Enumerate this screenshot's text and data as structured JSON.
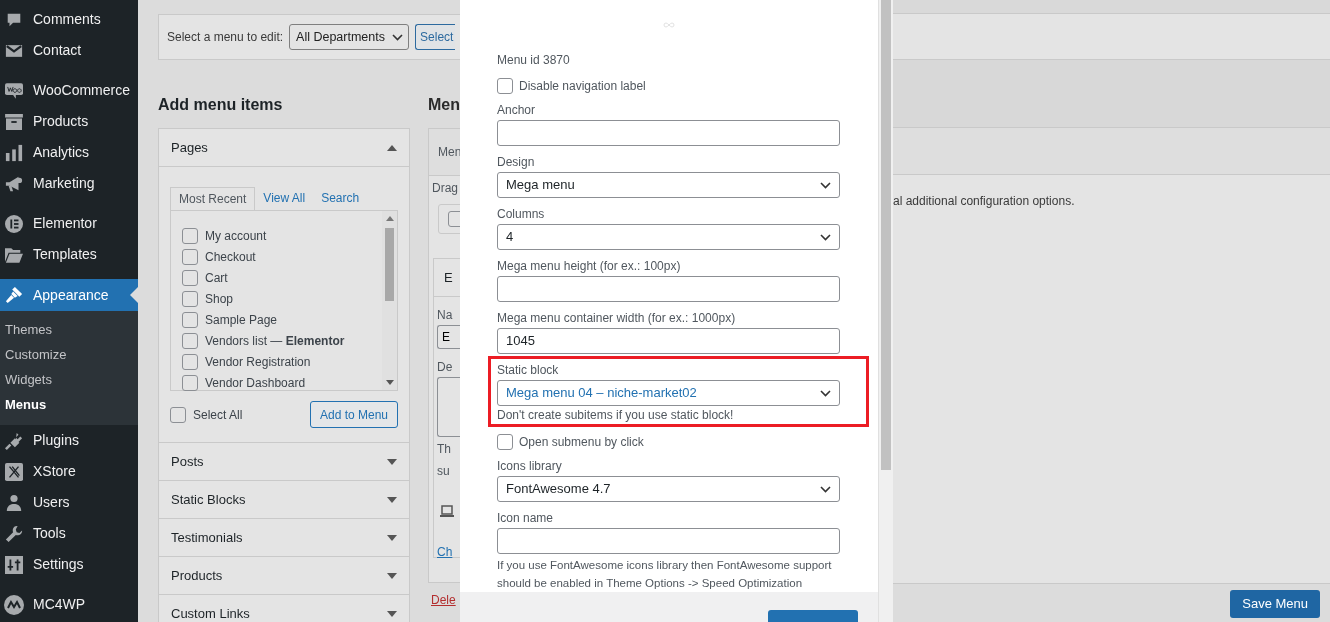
{
  "sidebar": {
    "items": [
      {
        "kind": "item",
        "label": "Comments",
        "selected": false
      },
      {
        "kind": "item",
        "label": "Contact",
        "selected": false
      },
      {
        "kind": "separator"
      },
      {
        "kind": "item",
        "label": "WooCommerce",
        "selected": false
      },
      {
        "kind": "item",
        "label": "Products",
        "selected": false
      },
      {
        "kind": "item",
        "label": "Analytics",
        "selected": false
      },
      {
        "kind": "item",
        "label": "Marketing",
        "selected": false
      },
      {
        "kind": "separator"
      },
      {
        "kind": "item",
        "label": "Elementor",
        "selected": false
      },
      {
        "kind": "item",
        "label": "Templates",
        "selected": false
      },
      {
        "kind": "separator"
      },
      {
        "kind": "item",
        "label": "Appearance",
        "selected": true,
        "children": [
          {
            "label": "Themes",
            "selected": false
          },
          {
            "label": "Customize",
            "selected": false
          },
          {
            "label": "Widgets",
            "selected": false
          },
          {
            "label": "Menus",
            "selected": true
          }
        ]
      },
      {
        "kind": "item",
        "label": "Plugins",
        "selected": false
      },
      {
        "kind": "item",
        "label": "XStore",
        "selected": false
      },
      {
        "kind": "item",
        "label": "Users",
        "selected": false
      },
      {
        "kind": "item",
        "label": "Tools",
        "selected": false
      },
      {
        "kind": "item",
        "label": "Settings",
        "selected": false
      },
      {
        "kind": "separator"
      },
      {
        "kind": "item",
        "label": "MC4WP",
        "selected": false
      }
    ]
  },
  "menu_select": {
    "label": "Select a menu to edit:",
    "value": "All Departments",
    "button": "Select"
  },
  "add_items": {
    "heading": "Add menu items",
    "pages": {
      "title": "Pages",
      "expanded": true,
      "tabs": [
        {
          "label": "Most Recent",
          "selected": true
        },
        {
          "label": "View All",
          "selected": false
        },
        {
          "label": "Search",
          "selected": false
        }
      ],
      "items": [
        {
          "label": "My account",
          "checked": false
        },
        {
          "label": "Checkout",
          "checked": false
        },
        {
          "label": "Cart",
          "checked": false
        },
        {
          "label": "Shop",
          "checked": false
        },
        {
          "label": "Sample Page",
          "checked": false
        },
        {
          "label": "Vendors list — **Elementor**",
          "checked": false
        },
        {
          "label": "Vendor Registration",
          "checked": false
        },
        {
          "label": "Vendor Dashboard",
          "checked": false
        }
      ],
      "select_all": {
        "label": "Select All",
        "checked": false
      },
      "add_button": "Add to Menu"
    },
    "sections": [
      {
        "title": "Posts",
        "expanded": false
      },
      {
        "title": "Static Blocks",
        "expanded": false
      },
      {
        "title": "Testimonials",
        "expanded": false
      },
      {
        "title": "Products",
        "expanded": false
      },
      {
        "title": "Custom Links",
        "expanded": false
      }
    ]
  },
  "menu_structure_fragments": [
    {
      "kind": "heading",
      "text": "Men"
    },
    {
      "kind": "tab",
      "text": "Men"
    },
    {
      "kind": "text",
      "text": "Drag"
    },
    {
      "kind": "checkbox"
    },
    {
      "kind": "item_header",
      "text": "E"
    },
    {
      "kind": "label",
      "text": "Na"
    },
    {
      "kind": "field",
      "text": "E"
    },
    {
      "kind": "label",
      "text": "De"
    },
    {
      "kind": "textarea"
    },
    {
      "kind": "text",
      "text": "Th"
    },
    {
      "kind": "text",
      "text": "su"
    },
    {
      "kind": "device"
    },
    {
      "kind": "link",
      "text": "Ch"
    },
    {
      "kind": "delete",
      "text": "Dele"
    }
  ],
  "modal": {
    "fields": [
      {
        "kind": "id",
        "text": "Menu id 3870"
      },
      {
        "kind": "checkbox",
        "label": "Disable navigation label",
        "checked": false
      },
      {
        "kind": "input",
        "label": "Anchor",
        "highlighted": false
      },
      {
        "kind": "select",
        "label": "Design",
        "value": "Mega menu",
        "hovered": false,
        "highlighted": false
      },
      {
        "kind": "select",
        "label": "Columns",
        "value": "4",
        "hovered": false,
        "highlighted": false
      },
      {
        "kind": "input",
        "label": "Mega menu height (for ex.: 100px)",
        "highlighted": false
      },
      {
        "kind": "input",
        "label": "Mega menu container width (for ex.: 1000px)",
        "value": "1045",
        "highlighted": false
      },
      {
        "kind": "select",
        "label": "Static block",
        "value": "Mega menu 04 – niche-market02",
        "hovered": true,
        "highlighted": true,
        "note": "Don't create subitems if you use static block!"
      },
      {
        "kind": "checkbox",
        "label": "Open submenu by click",
        "checked": false
      },
      {
        "kind": "select",
        "label": "Icons library",
        "value": "FontAwesome 4.7",
        "hovered": false,
        "highlighted": false
      },
      {
        "kind": "input",
        "label": "Icon name",
        "highlighted": false
      },
      {
        "kind": "help",
        "text": "If you use FontAwesome icons library then FontAwesome support should be enabled in Theme Options -> Speed Optimization"
      }
    ]
  },
  "right_panel": {
    "instructions": "al additional configuration options.",
    "save_button": "Save Menu"
  }
}
